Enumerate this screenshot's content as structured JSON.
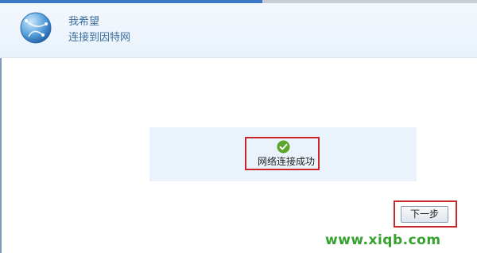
{
  "header": {
    "line1": "我希望",
    "line2": "连接到因特网",
    "icon": "globe-icon"
  },
  "status": {
    "icon": "check-circle-icon",
    "text": "网络连接成功"
  },
  "buttons": {
    "next_label": "下一步"
  },
  "watermark": {
    "text": "www.xiqb.com"
  },
  "colors": {
    "accent": "#3b79c8",
    "header_text": "#3d6e9f",
    "highlight_red": "#c9262b",
    "success_green": "#5aa628",
    "watermark_green": "#35a12e"
  }
}
